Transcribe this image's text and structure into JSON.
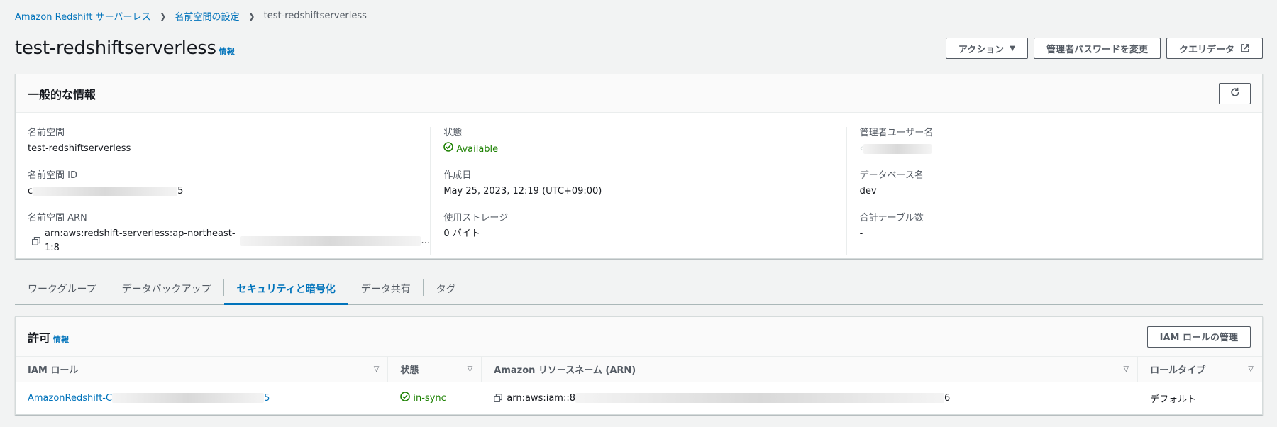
{
  "breadcrumb": {
    "items": [
      "Amazon Redshift サーバーレス",
      "名前空間の設定"
    ],
    "current": "test-redshiftserverless"
  },
  "header": {
    "title": "test-redshiftserverless",
    "info": "情報",
    "actions_label": "アクション",
    "change_password_label": "管理者パスワードを変更",
    "query_data_label": "クエリデータ"
  },
  "general": {
    "title": "一般的な情報",
    "namespace_label": "名前空間",
    "namespace_value": "test-redshiftserverless",
    "namespace_id_label": "名前空間 ID",
    "namespace_id_prefix": "c",
    "namespace_id_suffix": "5",
    "namespace_arn_label": "名前空間 ARN",
    "namespace_arn_value": "arn:aws:redshift-serverless:ap-northeast-1:8",
    "namespace_arn_ellipsis": "…",
    "status_label": "状態",
    "status_value": "Available",
    "created_label": "作成日",
    "created_value": "May 25, 2023, 12:19 (UTC+09:00)",
    "storage_label": "使用ストレージ",
    "storage_value": "0 バイト",
    "admin_user_label": "管理者ユーザー名",
    "admin_user_prefix": "‹",
    "database_label": "データベース名",
    "database_value": "dev",
    "tables_label": "合計テーブル数",
    "tables_value": "-"
  },
  "tabs": [
    {
      "label": "ワークグループ"
    },
    {
      "label": "データバックアップ"
    },
    {
      "label": "セキュリティと暗号化"
    },
    {
      "label": "データ共有"
    },
    {
      "label": "タグ"
    }
  ],
  "permissions": {
    "title": "許可",
    "info": "情報",
    "manage_button": "IAM ロールの管理",
    "columns": [
      "IAM ロール",
      "状態",
      "Amazon リソースネーム (ARN)",
      "ロールタイプ"
    ],
    "rows": [
      {
        "role_prefix": "AmazonRedshift-C",
        "role_suffix": "5",
        "status": "in-sync",
        "arn_prefix": "arn:aws:iam::8",
        "arn_suffix": "6",
        "type": "デフォルト"
      }
    ]
  },
  "colors": {
    "link": "#0073bb",
    "success": "#1d8102",
    "border": "#545b64"
  }
}
